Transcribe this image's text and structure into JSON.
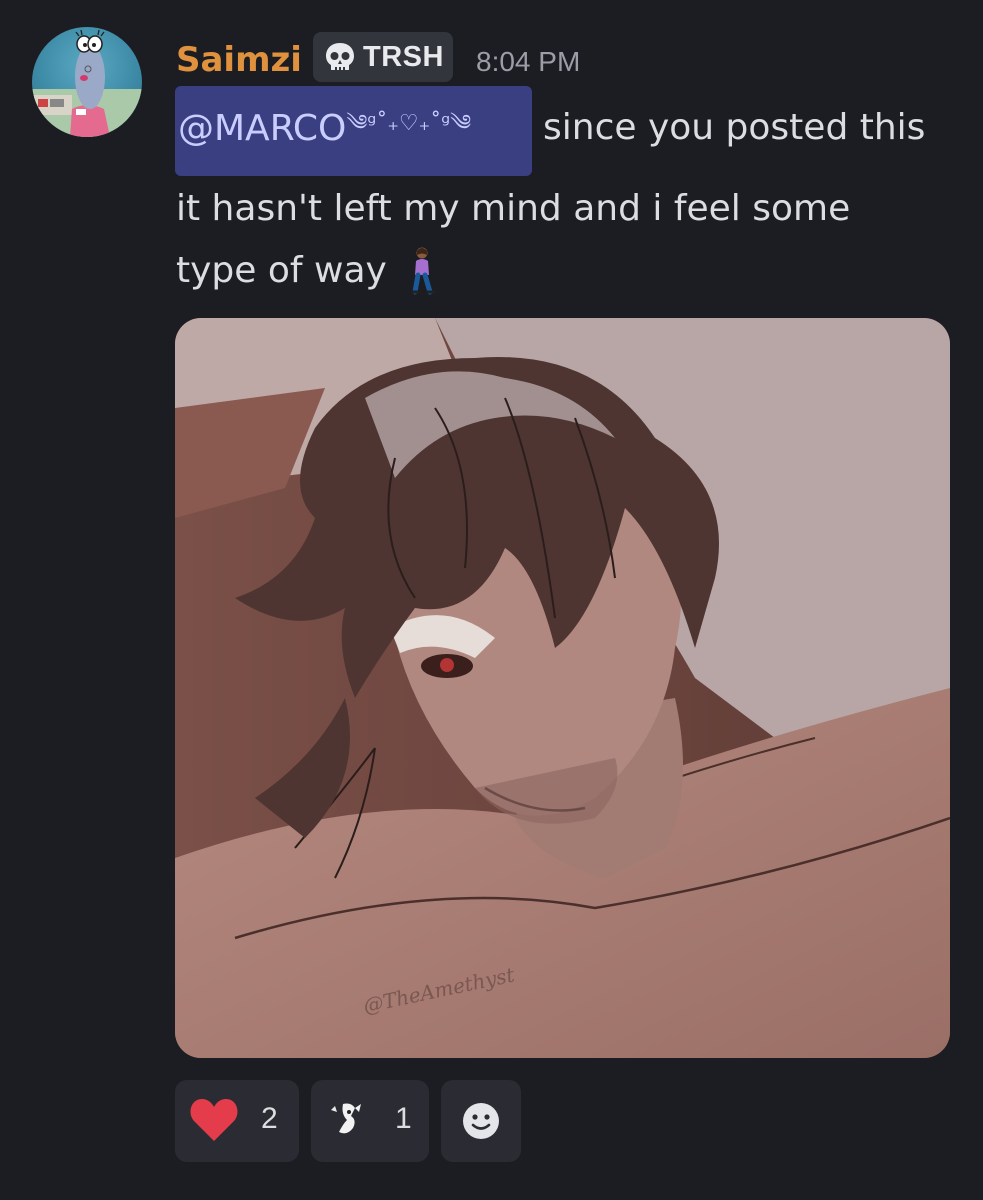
{
  "message": {
    "author": "Saimzi",
    "role_tag": "TRSH",
    "timestamp": "8:04 PM",
    "mention": "@MARCO",
    "mention_decoration": "༄ᵍ˚₊♡₊˚ᵍ༄",
    "text_line_1": "since you posted this",
    "text_line_2": "it hasn't left my mind and i feel some",
    "text_line_3": "type of way",
    "emoji": "woman-walking-emoji"
  },
  "attachment": {
    "type": "image",
    "signature": "@TheAmethyst"
  },
  "reactions": [
    {
      "icon": "heart-icon",
      "count": "2",
      "color": "#e43c4a"
    },
    {
      "icon": "custom-emoji-icon",
      "count": "1"
    },
    {
      "icon": "add-reaction-icon"
    }
  ],
  "colors": {
    "background": "#1c1d22",
    "username": "#e0913d",
    "mention_bg": "#3a3f82",
    "mention_text": "#c9ceff"
  }
}
